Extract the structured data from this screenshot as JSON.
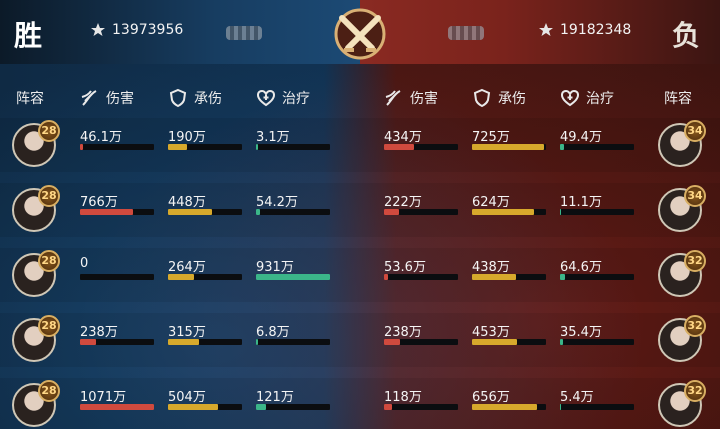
{
  "header": {
    "left_result": "胜",
    "right_result": "负",
    "left_power": "13973956",
    "right_power": "19182348"
  },
  "columns": {
    "lineup": "阵容",
    "damage": "伤害",
    "tank": "承伤",
    "heal": "治疗"
  },
  "left_team": [
    {
      "level": "28",
      "damage": "46.1万",
      "damage_fill": 0.04,
      "tank": "190万",
      "tank_fill": 0.25,
      "heal": "3.1万",
      "heal_fill": 0.03
    },
    {
      "level": "28",
      "damage": "766万",
      "damage_fill": 0.72,
      "tank": "448万",
      "tank_fill": 0.6,
      "heal": "54.2万",
      "heal_fill": 0.06
    },
    {
      "level": "28",
      "damage": "0",
      "damage_fill": 0.0,
      "tank": "264万",
      "tank_fill": 0.35,
      "heal": "931万",
      "heal_fill": 1.0
    },
    {
      "level": "28",
      "damage": "238万",
      "damage_fill": 0.22,
      "tank": "315万",
      "tank_fill": 0.42,
      "heal": "6.8万",
      "heal_fill": 0.03
    },
    {
      "level": "28",
      "damage": "1071万",
      "damage_fill": 1.0,
      "tank": "504万",
      "tank_fill": 0.67,
      "heal": "121万",
      "heal_fill": 0.13
    }
  ],
  "right_team": [
    {
      "level": "34",
      "damage": "434万",
      "damage_fill": 0.4,
      "tank": "725万",
      "tank_fill": 0.97,
      "heal": "49.4万",
      "heal_fill": 0.05
    },
    {
      "level": "34",
      "damage": "222万",
      "damage_fill": 0.2,
      "tank": "624万",
      "tank_fill": 0.84,
      "heal": "11.1万",
      "heal_fill": 0.02
    },
    {
      "level": "32",
      "damage": "53.6万",
      "damage_fill": 0.05,
      "tank": "438万",
      "tank_fill": 0.59,
      "heal": "64.6万",
      "heal_fill": 0.07
    },
    {
      "level": "32",
      "damage": "238万",
      "damage_fill": 0.22,
      "tank": "453万",
      "tank_fill": 0.61,
      "heal": "35.4万",
      "heal_fill": 0.04
    },
    {
      "level": "32",
      "damage": "118万",
      "damage_fill": 0.11,
      "tank": "656万",
      "tank_fill": 0.88,
      "heal": "5.4万",
      "heal_fill": 0.01
    }
  ],
  "colors": {
    "damage_bar": "#d04a3e",
    "tank_bar": "#d7a92c",
    "heal_bar": "#3bb689",
    "left_accent": "#1c4a75",
    "right_accent": "#8a2a22"
  }
}
